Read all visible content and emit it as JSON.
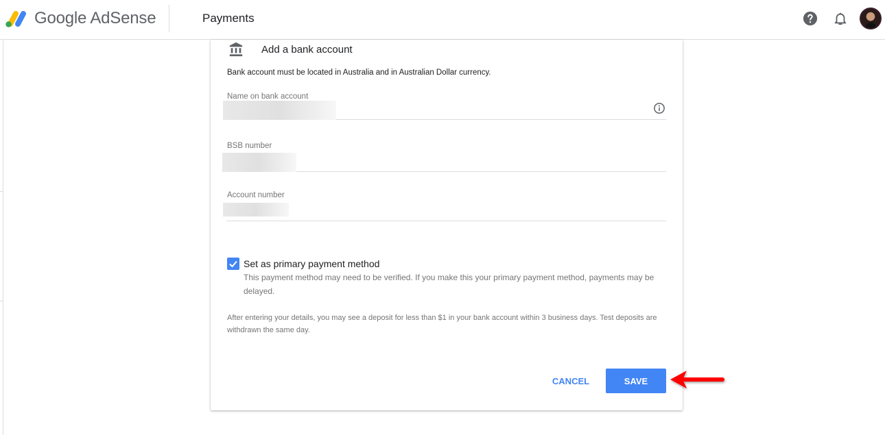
{
  "header": {
    "brand": "Google AdSense",
    "page_title": "Payments",
    "icons": [
      "adsense-logo-icon",
      "help-icon",
      "notifications-bell-icon",
      "user-avatar"
    ]
  },
  "card": {
    "icon": "bank-icon",
    "title": "Add a bank account",
    "intro": "Bank account must be located in Australia and in Australian Dollar currency.",
    "fields": [
      {
        "label": "Name on bank account",
        "value": "",
        "redacted": true,
        "trailing_icon": "info-icon"
      },
      {
        "label": "BSB number",
        "value": "",
        "redacted": true
      },
      {
        "label": "Account number",
        "value": "",
        "redacted": true
      }
    ],
    "primary_checkbox": {
      "checked": true,
      "label": "Set as primary payment method",
      "help": "This payment method may need to be verified. If you make this your primary payment method, payments may be delayed."
    },
    "note": "After entering your details, you may see a deposit for less than $1 in your bank account within 3 business days. Test deposits are withdrawn the same day.",
    "actions": {
      "cancel_label": "CANCEL",
      "save_label": "SAVE"
    }
  },
  "annotation": {
    "arrow_color": "#ff0000",
    "points_to": "save-button"
  },
  "colors": {
    "accent": "#4285f4",
    "divider": "#dadce0",
    "secondary_text": "#757575"
  }
}
